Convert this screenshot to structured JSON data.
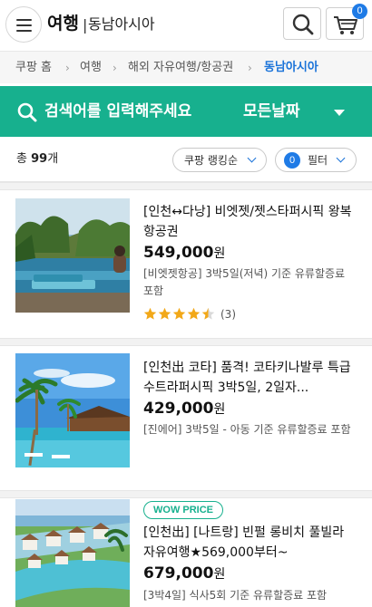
{
  "header": {
    "title": "여행",
    "separator": "|",
    "subtitle": "동남아시아",
    "cart_count": "0"
  },
  "breadcrumb": {
    "items": [
      "쿠팡 홈",
      "여행",
      "해외 자유여행/항공권",
      "동남아시아"
    ]
  },
  "search": {
    "placeholder": "검색어를 입력해주세요",
    "date_label": "모든날짜"
  },
  "results": {
    "total_prefix": "총 ",
    "total_count": "99",
    "total_suffix": "개",
    "sort_label": "쿠팡 랭킹순",
    "filter_count": "0",
    "filter_label": "필터"
  },
  "products": [
    {
      "title": "[인천↔다낭] 비엣젯/젯스타퍼시픽 왕복항공권",
      "price": "549,000",
      "currency": "원",
      "description": "[비엣젯항공] 3박5일(저녁) 기준 유류할증료 포함",
      "rating": 4.5,
      "review_count": "(3)"
    },
    {
      "title": "[인천出 코타] 품격! 코타키나발루 특급 수트라퍼시픽 3박5일, 2일자...",
      "price": "429,000",
      "currency": "원",
      "description": "[진에어] 3박5일 - 아동 기준 유류할증료 포함"
    },
    {
      "badge": "WOW PRICE",
      "title": "[인천出] [나트랑] 빈펄 롱비치 풀빌라 자유여행★569,000부터~",
      "price": "679,000",
      "currency": "원",
      "description": "[3박4일] 식사5회 기준 유류할증료 포함"
    }
  ],
  "colors": {
    "accent_green": "#17b08e",
    "accent_blue": "#1a73d9",
    "star": "#f2a818"
  }
}
